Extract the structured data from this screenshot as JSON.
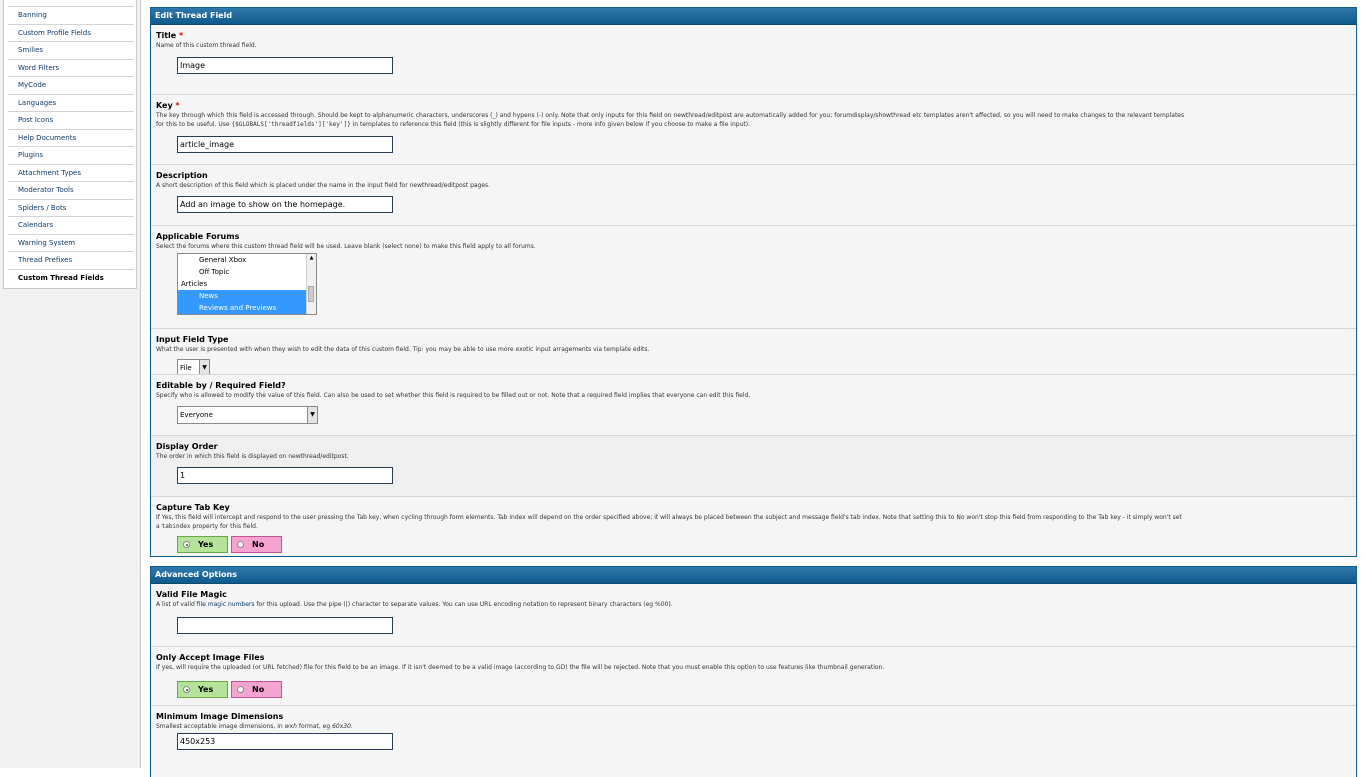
{
  "sidebar": {
    "items": [
      {
        "label": "Banning"
      },
      {
        "label": "Custom Profile Fields"
      },
      {
        "label": "Smilies"
      },
      {
        "label": "Word Filters"
      },
      {
        "label": "MyCode"
      },
      {
        "label": "Languages"
      },
      {
        "label": "Post Icons"
      },
      {
        "label": "Help Documents"
      },
      {
        "label": "Plugins"
      },
      {
        "label": "Attachment Types"
      },
      {
        "label": "Moderator Tools"
      },
      {
        "label": "Spiders / Bots"
      },
      {
        "label": "Calendars"
      },
      {
        "label": "Warning System"
      },
      {
        "label": "Thread Prefixes"
      },
      {
        "label": "Custom Thread Fields"
      }
    ],
    "active": "Custom Thread Fields"
  },
  "edit": {
    "heading": "Edit Thread Field",
    "title": {
      "label": "Title",
      "required_mark": "*",
      "desc": "Name of this custom thread field.",
      "value": "Image"
    },
    "key": {
      "label": "Key",
      "required_mark": "*",
      "desc1": "The key through which this field is accessed through.  Should be kept to alphanumeric characters, underscores (_) and hypens (-) only.  Note that only inputs for this field on newthread/editpost are automatically added for you; forumdisplay/showthread etc templates aren't affected, so you will need to make changes to the relevant templates",
      "desc2_a": "for this to be useful.  Use ",
      "desc2_code": "{$GLOBALS['threadfields']['key']}",
      "desc2_b": " in templates to reference this field (this is slightly different for file inputs - more info given below if you choose to make a file input).",
      "value": "article_image"
    },
    "description": {
      "label": "Description",
      "desc": "A short description of this field which is placed under the name in the input field for newthread/editpost pages.",
      "value": "Add  an  image  to  show  on  the  homepage."
    },
    "forums": {
      "label": "Applicable Forums",
      "desc": "Select the forums where this custom thread field will be used.  Leave blank (select none) to make this field apply to all forums.",
      "options": [
        {
          "label": "General  Xbox",
          "indent": true,
          "selected": false
        },
        {
          "label": "Off  Topic",
          "indent": true,
          "selected": false
        },
        {
          "label": "Articles",
          "indent": false,
          "selected": false
        },
        {
          "label": "News",
          "indent": true,
          "selected": true
        },
        {
          "label": "Reviews  and  Previews",
          "indent": true,
          "selected": true
        }
      ]
    },
    "input_type": {
      "label": "Input Field Type",
      "desc": "What the user is presented with when they wish to edit the data of this custom field. Tip: you may be able to use more exotic input arragements via template edits.",
      "value": "File"
    },
    "editable": {
      "label": "Editable by / Required Field?",
      "desc": "Specify who is allowed to modify the value of this field. Can also be used to set whether this field is required to be filled out or not. Note that a required field implies that everyone can edit this field.",
      "value": "Everyone"
    },
    "display_order": {
      "label": "Display Order",
      "desc": "The order in which this field is displayed on newthread/editpost.",
      "value": "1"
    },
    "tab_key": {
      "label": "Capture Tab Key",
      "desc1": "If Yes, this field will intercept and respond to the user pressing the Tab key, when cycling through form elements. Tab index will depend on the order specified above; it will always be placed between the subject and message field's tab index. Note that setting this to No won't stop this field from responding to the Tab key - it simply won't set",
      "desc2_a": "a ",
      "desc2_code": "tabindex",
      "desc2_b": " property for this field.",
      "yes": "Yes",
      "no": "No",
      "selected": "Yes"
    }
  },
  "advanced": {
    "heading": "Advanced Options",
    "magic": {
      "label": "Valid File Magic",
      "desc_a": "A list of valid ",
      "desc_link": "file magic numbers",
      "desc_b": " for this upload.  Use the pipe (|) character to separate values.  You can use URL encoding notation to represent binary characters (eg %00).",
      "value": ""
    },
    "image_only": {
      "label": "Only Accept Image Files",
      "desc": "If yes, will require the uploaded (or URL fetched) file for this field to be an image.  If it isn't deemed to be a valid image (according to GD) the file will be rejected. Note that you must enable this option to use features like thumbnail generation.",
      "yes": "Yes",
      "no": "No",
      "selected": "Yes"
    },
    "min_dims": {
      "label": "Minimum Image Dimensions",
      "desc_a": "Smallest acceptable image dimensions, in ",
      "desc_em1": "w",
      "desc_x": "x",
      "desc_em2": "h",
      "desc_b": " format, eg ",
      "desc_eg": "60x30",
      "desc_c": ".",
      "value": "450x253"
    }
  }
}
